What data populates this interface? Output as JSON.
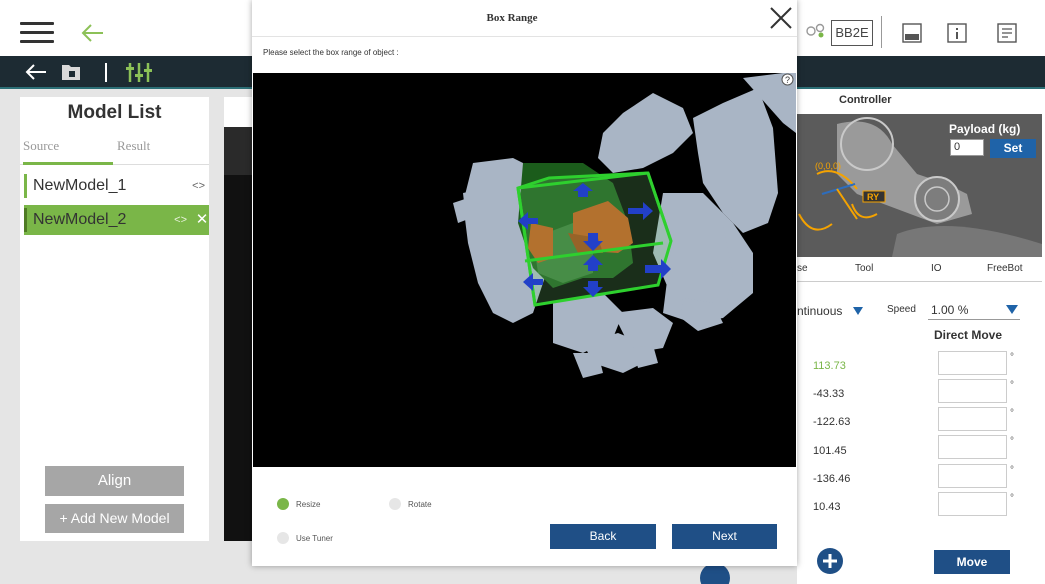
{
  "left_panel": {
    "title": "Model List",
    "tabs": [
      {
        "label": "Source",
        "active": true
      },
      {
        "label": "Result",
        "active": false
      }
    ],
    "models": [
      {
        "name": "NewModel_1",
        "selected": false
      },
      {
        "name": "NewModel_2",
        "selected": true
      }
    ],
    "align_label": "Align",
    "add_model_label": "+ Add New Model"
  },
  "topbar": {
    "device_badge": "BB2E"
  },
  "right_panel": {
    "controller_label": "Controller",
    "payload_label": "Payload (kg)",
    "payload_value": "0",
    "set_label": "Set",
    "robot_labels": {
      "origin": "(0,0,0)",
      "axis": "RY"
    },
    "tabs": [
      "se",
      "Tool",
      "IO",
      "FreeBot"
    ],
    "mode_value": "ntinuous",
    "speed_label": "Speed",
    "speed_value": "1.00 %",
    "direct_move_label": "Direct Move",
    "joints": [
      {
        "value": "113.73",
        "highlight": true
      },
      {
        "value": "-43.33",
        "highlight": false
      },
      {
        "value": "-122.63",
        "highlight": false
      },
      {
        "value": "101.45",
        "highlight": false
      },
      {
        "value": "-136.46",
        "highlight": false
      },
      {
        "value": "10.43",
        "highlight": false
      }
    ],
    "degree_symbol": "°",
    "move_label": "Move"
  },
  "modal": {
    "title": "Box Range",
    "instruction": "Please select the box range of object :",
    "options": [
      {
        "label": "Resize",
        "selected": true
      },
      {
        "label": "Rotate",
        "selected": false
      },
      {
        "label": "Use Tuner",
        "selected": false
      }
    ],
    "back_label": "Back",
    "next_label": "Next"
  },
  "colors": {
    "accent_green": "#7ab648",
    "button_blue": "#1f4f86",
    "set_blue": "#1f63a8",
    "dark_bar": "#1d2b33"
  }
}
